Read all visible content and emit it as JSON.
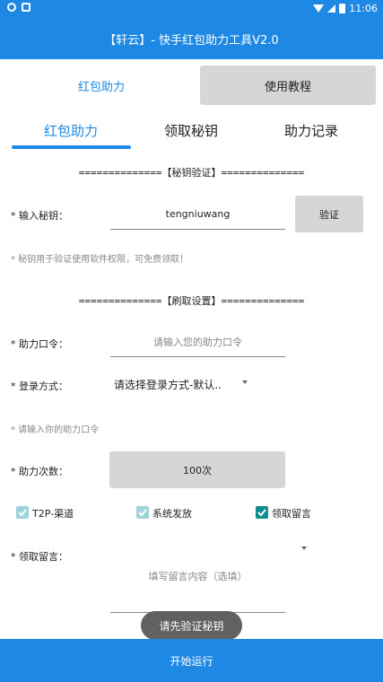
{
  "status_bar": {
    "time": "11:06",
    "icons": [
      "record-icon",
      "notification-icon",
      "wifi-icon",
      "signal-icon",
      "battery-icon"
    ]
  },
  "app_bar": {
    "title": "【轩云】- 快手红包助力工具V2.0"
  },
  "top_tabs": {
    "tab1": "红包助力",
    "tab2": "使用教程"
  },
  "sub_tabs": {
    "tab1": "红包助力",
    "tab2": "领取秘钥",
    "tab3": "助力记录"
  },
  "key_section": {
    "title": "==============【秘钥验证】==============",
    "label": "* 输入秘钥：",
    "value": "tengniuwang",
    "verify_button": "验证",
    "hint": "* 秘钥用于验证使用软件权限，可免费领取！"
  },
  "settings_section": {
    "title": "==============【刷取设置】==============",
    "command_label": "* 助力口令：",
    "command_placeholder": "请输入您的助力口令",
    "login_label": "* 登录方式：",
    "login_value": "请选择登录方式-默认..",
    "command_hint": "* 请输入你的助力口令",
    "count_label": "* 助力次数：",
    "count_value": "100次",
    "checkboxes": [
      {
        "label": "T2P-渠道",
        "checked": true
      },
      {
        "label": "系统发放",
        "checked": true
      },
      {
        "label": "领取留言",
        "checked": true
      }
    ],
    "message_label": "* 领取留言：",
    "message_placeholder": "填写留言内容（选填）"
  },
  "toast": "请先验证秘钥",
  "bottom_button": "开始运行",
  "colors": {
    "primary": "#1e88e5",
    "button_gray": "#d6d6d6",
    "check_dark": "#118c8c",
    "check_light": "#9fd3db"
  }
}
